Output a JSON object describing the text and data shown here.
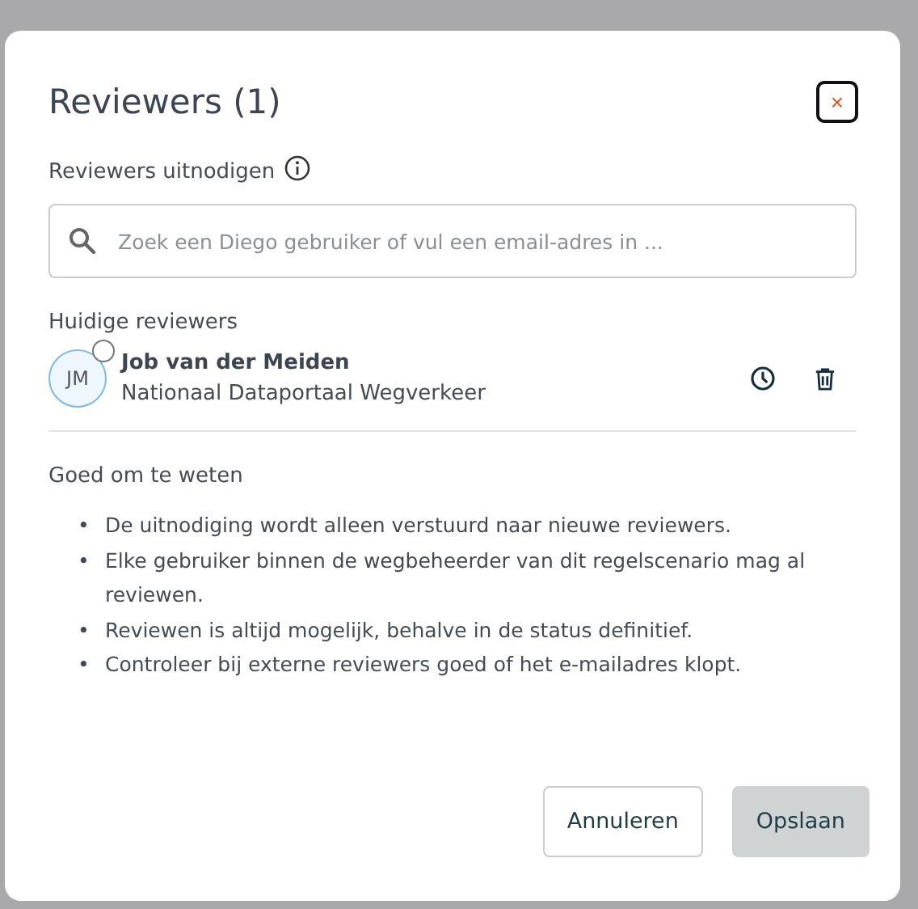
{
  "dialog": {
    "title": "Reviewers (1)",
    "close_icon": "×"
  },
  "invite": {
    "label": "Reviewers uitnodigen",
    "placeholder": "Zoek een Diego gebruiker of vul een email-adres in ..."
  },
  "current": {
    "heading": "Huidige reviewers",
    "reviewers": [
      {
        "initials": "JM",
        "name": "Job van der Meiden",
        "organisation": "Nationaal Dataportaal Wegverkeer"
      }
    ]
  },
  "info": {
    "heading": "Goed om te weten",
    "bullet": "•",
    "items": [
      "De uitnodiging wordt alleen verstuurd naar nieuwe reviewers.",
      "Elke gebruiker binnen de wegbeheerder van dit regelscenario mag al reviewen.",
      "Reviewen is altijd mogelijk, behalve in de status definitief.",
      "Controleer bij externe reviewers goed of het e-mailadres klopt."
    ]
  },
  "buttons": [
    {
      "label": "Annuleren",
      "kind": "secondary",
      "disabled": false
    },
    {
      "label": "Opslaan",
      "kind": "primary",
      "disabled": true
    }
  ]
}
